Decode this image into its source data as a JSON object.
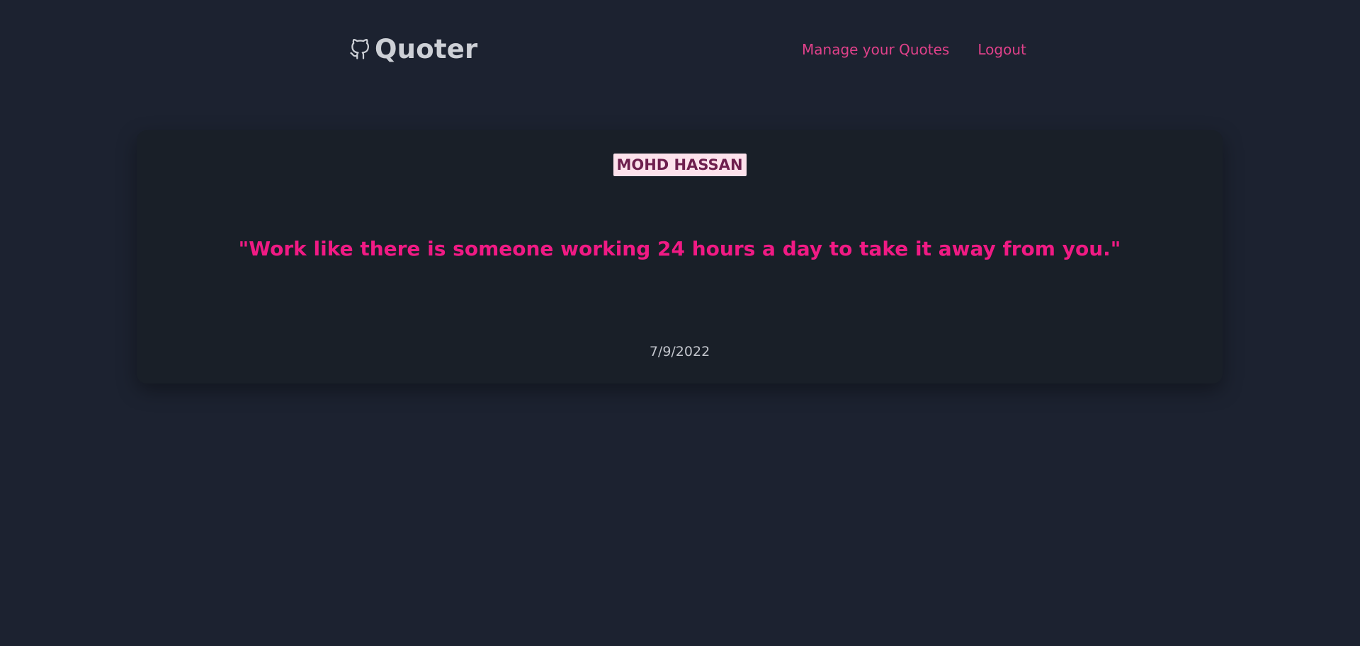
{
  "header": {
    "brand_title": "Quoter",
    "brand_icon": "github-icon",
    "nav_links": [
      {
        "label": "Manage your Quotes"
      },
      {
        "label": "Logout"
      }
    ]
  },
  "quote_card": {
    "author": "MOHD HASSAN",
    "text": "\"Work like there is someone working 24 hours a day to take it away from you.\"",
    "date": "7/9/2022"
  },
  "colors": {
    "background": "#1c2230",
    "card_background": "#191f28",
    "brand_text": "#cdd0d6",
    "nav_link": "#e0418a",
    "quote_text": "#f01a84",
    "author_badge_bg": "#fde2ec",
    "author_badge_text": "#6e1f4e",
    "date_text": "#c2c5cc"
  }
}
